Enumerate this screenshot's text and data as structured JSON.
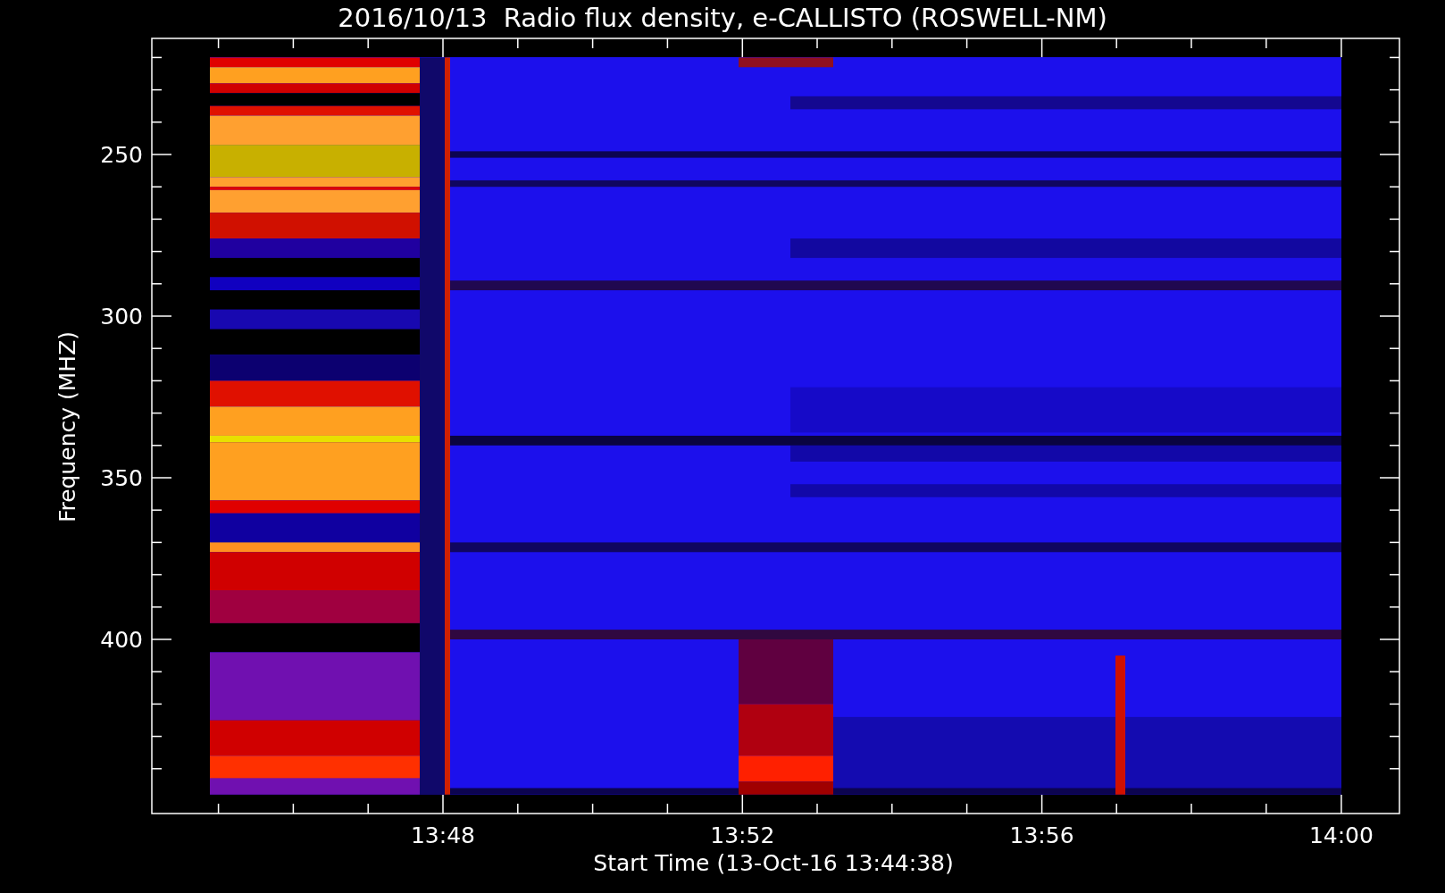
{
  "title": "2016/10/13  Radio flux density, e-CALLISTO (ROSWELL-NM)",
  "y_axis": {
    "label": "Frequency (MHZ)",
    "ticks": [
      "250",
      "300",
      "350",
      "400"
    ]
  },
  "x_axis": {
    "label": "Start Time (13-Oct-16 13:44:38)",
    "ticks": [
      "13:48",
      "13:52",
      "13:56",
      "14:00"
    ]
  }
}
